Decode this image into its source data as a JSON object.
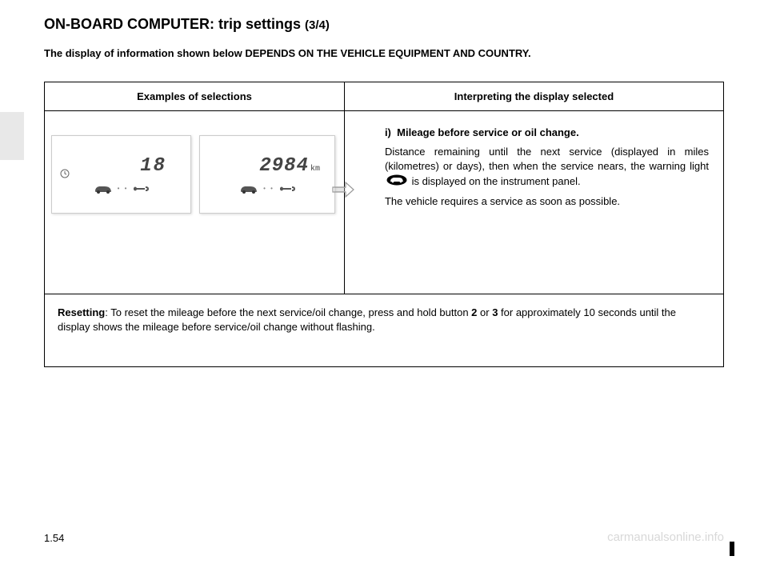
{
  "page": {
    "title_main": "ON-BOARD COMPUTER: trip settings",
    "title_sub": "(3/4)",
    "depends_note": "The display of information shown below DEPENDS ON THE VEHICLE EQUIPMENT AND COUNTRY.",
    "page_number": "1.54",
    "watermark": "carmanualsonline.info"
  },
  "table": {
    "header_left": "Examples of selections",
    "header_right": "Interpreting the display selected",
    "display1_value": "18",
    "display2_value": "2984",
    "display2_unit": "km",
    "interpret": {
      "item_id": "i)",
      "item_title": "Mileage before service or oil change.",
      "para1_a": "Distance remaining until the next service (displayed in miles (kilometres) or days), then when the service nears, the warning light ",
      "para1_b": " is displayed on the instrument panel.",
      "para2": "The vehicle requires a service as soon as possible."
    },
    "reset": {
      "label": "Resetting",
      "text_a": ": To reset the mileage before the next service/oil change, press and hold button ",
      "btn_a": "2",
      "text_b": " or ",
      "btn_b": "3",
      "text_c": "  for approximately 10 seconds until the display shows the mileage before service/oil change without flashing."
    }
  }
}
